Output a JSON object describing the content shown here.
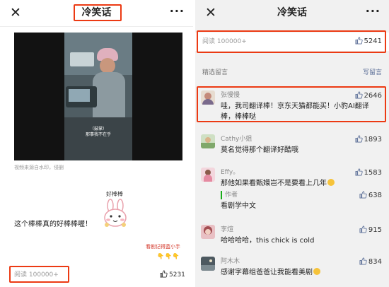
{
  "left": {
    "title": "冷笑话",
    "close_glyph": "✕",
    "more_glyph": "···",
    "video_caption_line1": "（鼓掌）",
    "video_caption_line2": "那事我不在乎",
    "source_note": "视频来源自水印，侵删",
    "sticker_label": "好棒棒",
    "joke_text": "这个棒棒真的好棒棒喔！",
    "tag_text": "看剧记得蓝小手",
    "hands": "👇👇👇",
    "read_count": "阅读 100000+",
    "like_count": "5231"
  },
  "right": {
    "title": "冷笑话",
    "close_glyph": "✕",
    "more_glyph": "···",
    "read_count": "阅读 100000+",
    "like_count": "5241",
    "section_title": "精选留言",
    "write_label": "写留言",
    "comments": [
      {
        "name": "张慢慢",
        "likes": "2646",
        "text": "哇，我司翻译棒！京东天猫都能买！小豹AI翻译棒，棒棒哒"
      },
      {
        "name": "Cathy小姐",
        "likes": "1893",
        "text": "莫名觉得那个翻译好酷哦"
      },
      {
        "name": "Effy。",
        "likes": "1583",
        "text": "那他如果看甄嬛岂不是要看上几年",
        "reply_author": "作者",
        "reply_likes": "638",
        "reply_text": "看剧学中文"
      },
      {
        "name": "李煊",
        "likes": "915",
        "text": "哈哈哈哈，this chick is cold"
      },
      {
        "name": "阿木木",
        "likes": "834",
        "text": "感谢字幕组爸爸让我能看美剧"
      }
    ]
  },
  "colors": {
    "highlight": "#ec3a13",
    "link": "#576b95",
    "reply_bar": "#1aad19"
  }
}
